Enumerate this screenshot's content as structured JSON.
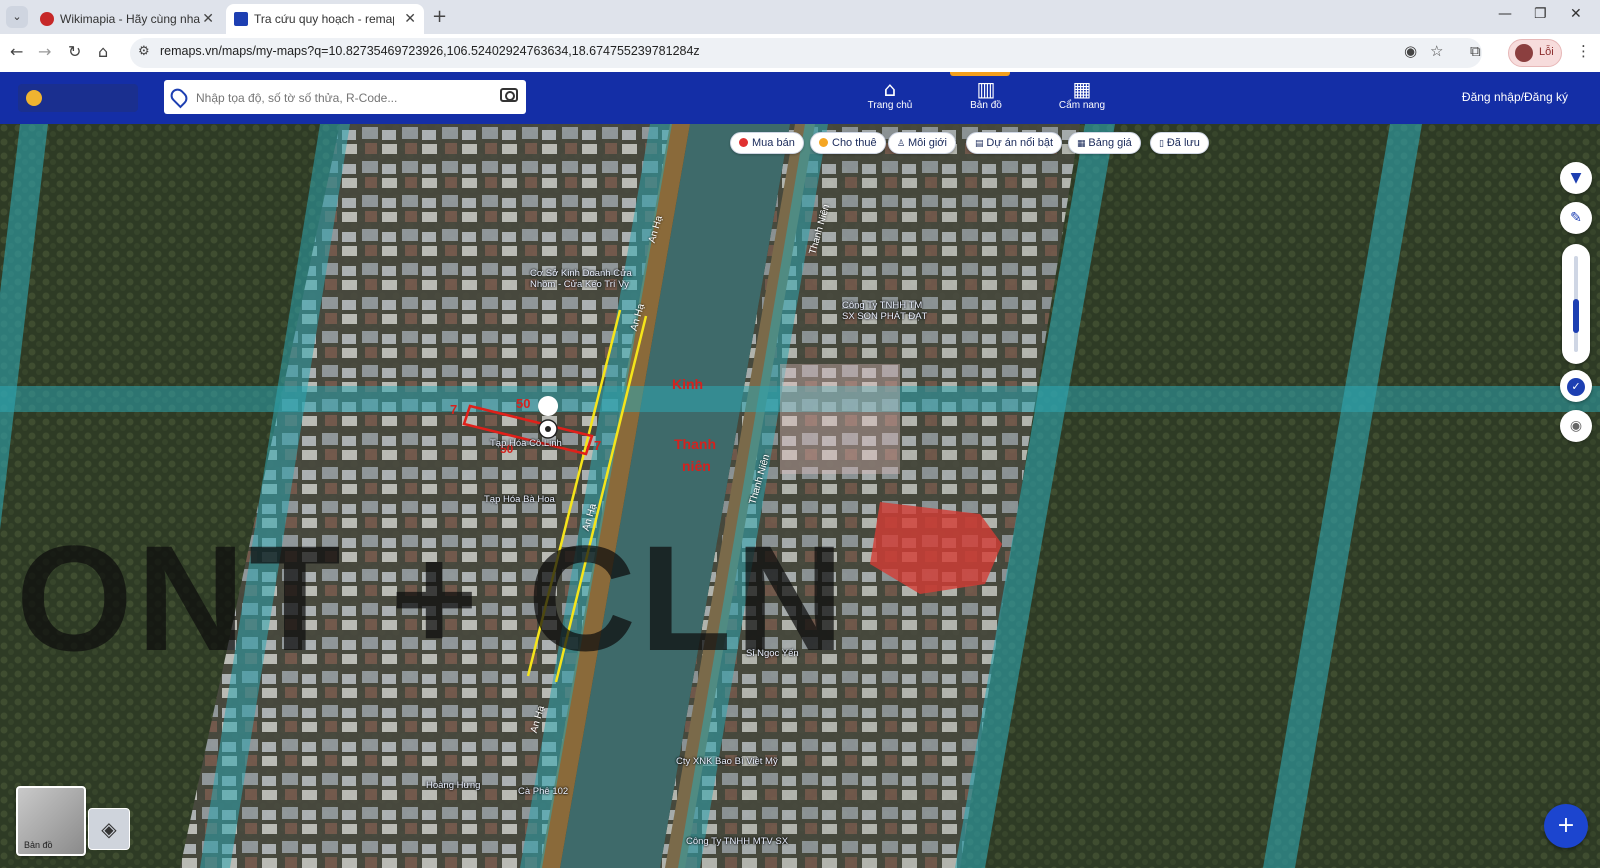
{
  "browser": {
    "tabs": [
      {
        "label": "Wikimapia - Hãy cùng nhau mô",
        "active": false
      },
      {
        "label": "Tra cứu quy hoạch - remaps.vn",
        "active": true
      }
    ],
    "url": "remaps.vn/maps/my-maps?q=10.82735469723926,106.52402924763634,18.674755239781284z",
    "profile_label": "Lỗi"
  },
  "app": {
    "search_placeholder": "Nhập tọa độ, số tờ số thửa, R-Code...",
    "nav": [
      {
        "label": "Trang chủ",
        "icon": "home-icon",
        "active": false
      },
      {
        "label": "Bản đồ",
        "icon": "map-icon",
        "active": true
      },
      {
        "label": "Cẩm nang",
        "icon": "handbook-icon",
        "active": false
      }
    ],
    "login_label": "Đăng nhập/Đăng ký"
  },
  "chips": [
    {
      "label": "Mua bán",
      "dot": "#e03131"
    },
    {
      "label": "Cho thuê",
      "dot": "#f5a623"
    },
    {
      "label": "Môi giới",
      "icon": "person-icon"
    },
    {
      "label": "Dự án nổi bật",
      "icon": "building-icon"
    },
    {
      "label": "Bảng giá",
      "icon": "table-icon"
    },
    {
      "label": "Đã lưu",
      "icon": "bookmark-icon"
    }
  ],
  "map": {
    "zoom_level": 0.2,
    "overlay_text": "ONT + CLN",
    "annotations": {
      "top_dim": "50",
      "side_left": "7",
      "side_right": "7",
      "bottom_dim": "50",
      "canal_label": "Kinh",
      "road_label_line1": "Thanh",
      "road_label_line2": "niên"
    },
    "street_labels": [
      "An Hạ",
      "An Hạ",
      "An Hạ",
      "An Hạ",
      "Thanh Niên",
      "Thanh Niên"
    ],
    "poi_labels": [
      "Cơ Sở Kinh Doanh Cửa Nhôm - Cửa Kéo Trí Vy",
      "Công Ty TNHH TM SX SON PHÁT ĐẠT",
      "Tạp Hóa Bà Hoa",
      "Tạp Hóa Cô Linh",
      "Sỉ Ngọc Yến",
      "Cty XNK Bao Bì Việt Mỹ",
      "Cà Phê 102",
      "Hoàng Hưng",
      "Công Ty TNHH MTV SX"
    ],
    "basemap_label": "Bản đồ"
  }
}
